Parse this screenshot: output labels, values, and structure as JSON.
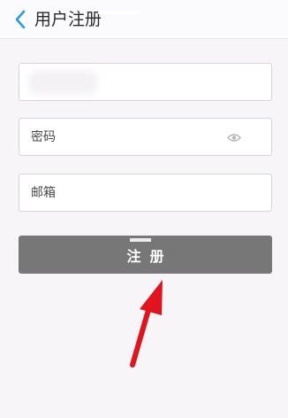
{
  "header": {
    "title": "用户注册",
    "back_icon": "chevron-left-icon"
  },
  "form": {
    "username": {
      "value": "",
      "placeholder": ""
    },
    "password": {
      "value": "",
      "placeholder": "密码",
      "toggle_icon": "eye-icon"
    },
    "email": {
      "value": "",
      "placeholder": "邮箱"
    },
    "submit_label": "注册"
  },
  "colors": {
    "accent": "#2a9bd8",
    "button": "#777777",
    "annotation_arrow": "#e0141e"
  }
}
